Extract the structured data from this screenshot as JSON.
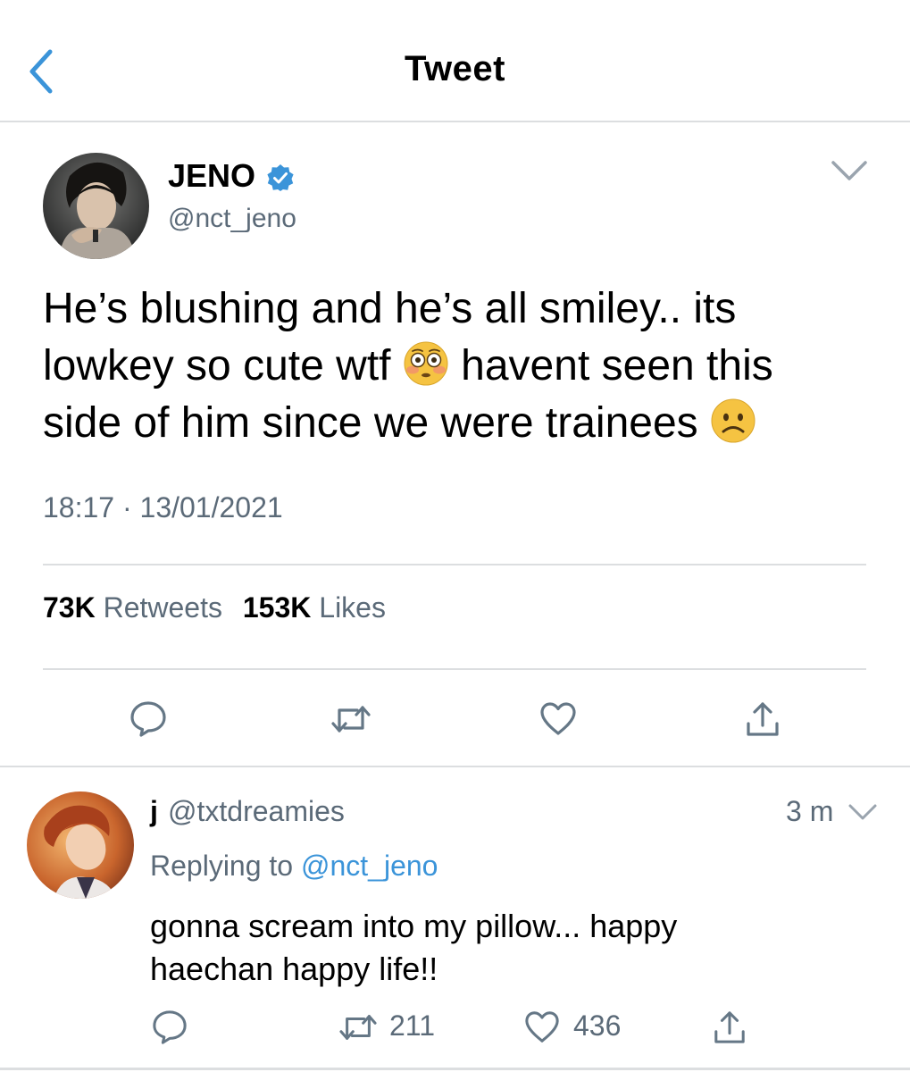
{
  "header": {
    "title": "Tweet"
  },
  "tweet": {
    "author": {
      "name": "JENO",
      "handle": "@nct_jeno",
      "verified": true
    },
    "text_line_1": "He’s blushing and he’s all smiley.. its",
    "text_line_2a": "lowkey so cute wtf ",
    "emoji_1": "flushed-face",
    "text_line_2b": " havent seen this",
    "text_line_3": "side of him since we were trainees ",
    "emoji_2": "frowning-face",
    "time": "18:17",
    "date": "13/01/2021",
    "separator": "·",
    "retweets": {
      "count": "73K",
      "label": "Retweets"
    },
    "likes": {
      "count": "153K",
      "label": "Likes"
    }
  },
  "reply": {
    "name": "j",
    "handle": "@txtdreamies",
    "time": "3 m",
    "replying_label": "Replying to ",
    "replying_to": "@nct_jeno",
    "text_line_1": "gonna scream into my pillow... happy",
    "text_line_2": "haechan happy life!!",
    "retweet_count": "211",
    "like_count": "436"
  },
  "colors": {
    "accent": "#3b94d9",
    "secondary_text": "#5b6a78",
    "divider": "#dcdee0",
    "icon": "#657786"
  },
  "icons": [
    "back-chevron-icon",
    "verified-badge-icon",
    "chevron-down-icon",
    "reply-icon",
    "retweet-icon",
    "like-icon",
    "share-icon"
  ]
}
